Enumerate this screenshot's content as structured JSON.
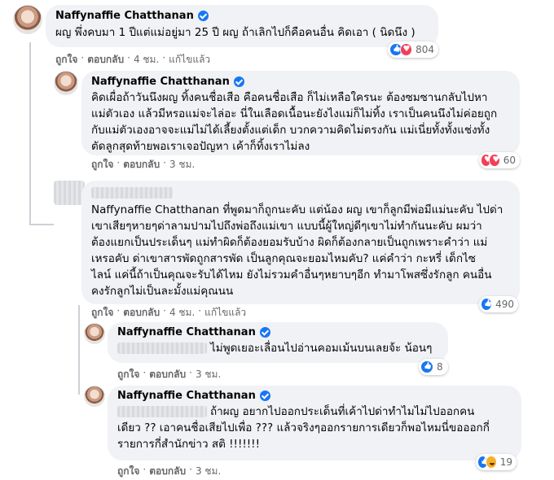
{
  "comments": [
    {
      "name": "Naffynaffie Chatthanan",
      "text_lines": [
        "ผญ พึ่งคบมา 1 ปีแต่แม่อยู่มา 25 ปี ผญ ถ้าเลิกไปก็คือคนอื่น คิดเอา ( นิดนึง )"
      ],
      "actions": {
        "like": "ถูกใจ",
        "reply": "ตอบกลับ",
        "time": "4 ชม.",
        "edited": "แก้ไขแล้ว"
      },
      "reaction_count": "804"
    },
    {
      "name": "Naffynaffie Chatthanan",
      "text_lines": [
        "คิดเผื่อถ้าวันนึงผญ ทิ้งคนชื่อเสือ คือคนชื่อเสือ ก็ไม่เหลือใครนะ ต้องซมซานกลับไปหา",
        "แม่ตัวเอง แล้วมีหรอแม่จะไล่อะ นี่ในเลือดเนื้อนะยังไงแม่ก็ไม่ทิ้ง เราเป็นคนนึงไม่ค่อยถูก",
        "กับแม่ตัวเองอาจจะแม่ไม่ได้เลี้ยงตั้งแต่เด็ก บวกความคิดไม่ตรงกัน แม่เนี่ยทั้งทั้งแช่งทั้ง",
        "ตัดลูกสุดท้ายพอเราเจอปัญหา เค้าก็ทิ้งเราไม่ลง"
      ],
      "actions": {
        "like": "ถูกใจ",
        "reply": "ตอบกลับ",
        "time": "3 ชม."
      },
      "reaction_count": "60"
    },
    {
      "text_lines": [
        "Naffynaffie Chatthanan ที่พูดมาก็ถูกนะคับ แต่น้อง ผญ เขาก็ลูกมีพ่อมีแม่นะคับ ไปด่า",
        "เขาเสียๆหายๆด่าลามปามไปถึงพ่อถึงแม่เขา แบบนี้ผู้ใหญ่ดีๆเขาไม่ทำกันนะคับ ผมว่า",
        "ต้องแยกเป็นประเด็นๆ แม่ทำผิดก็ต้องยอมรับบ้าง ผิดก็ต้องกลายเป็นถูกเพราะคำว่า แม่",
        "เหรอคับ ด่าเขาสารพัดถูกสารพัด เป็นลูกคุณจะยอมไหมคับ? แค่คำว่า กะหรี่ เด็กไซ",
        "ไลน์ แค่นี้ถ้าเป็นคุณจะรับได้ไหม ยังไม่รวมคำอื่นๆหยาบๆอีก ทำมาโพสซึ่งรักลูก คนอื่น",
        "คงรักลูกไม่เป็นละมั้งแม่คุณนน"
      ],
      "actions": {
        "like": "ถูกใจ",
        "reply": "ตอบกลับ",
        "time": "4 ชม.",
        "edited": "แก้ไขแล้ว"
      },
      "reaction_count": "490"
    },
    {
      "name": "Naffynaffie Chatthanan",
      "text_lines": [
        "ไม่พูดเยอะเลื่อนไปอ่านคอมเม้นบนเลยจ้ะ น้อนๆ"
      ],
      "actions": {
        "like": "ถูกใจ",
        "reply": "ตอบกลับ",
        "time": "3 ชม."
      },
      "reaction_count": "8"
    },
    {
      "name": "Naffynaffie Chatthanan",
      "text_lines": [
        "ถ้าผญ อยากไปออกประเด็นที่เค้าไปด่าทำไมไม่ไปออกคน",
        "เดียว ?? เอาคนชื่อเสียไปเพื่อ ??? แล้วจริงๆออกรายการเดียวก็พอไหมนี่ขอออกกี่",
        "รายการกี่สำนักข่าว สติ !!!!!!!"
      ],
      "actions": {
        "like": "ถูกใจ",
        "reply": "ตอบกลับ",
        "time": "3 ชม."
      },
      "reaction_count": "19"
    }
  ],
  "separator": "·",
  "colors": {
    "bubble": "#f0f2f5",
    "meta": "#65676b",
    "like_blue": "#1877f2",
    "love_red": "#f33e58",
    "haha_yellow": "#f7b125"
  }
}
